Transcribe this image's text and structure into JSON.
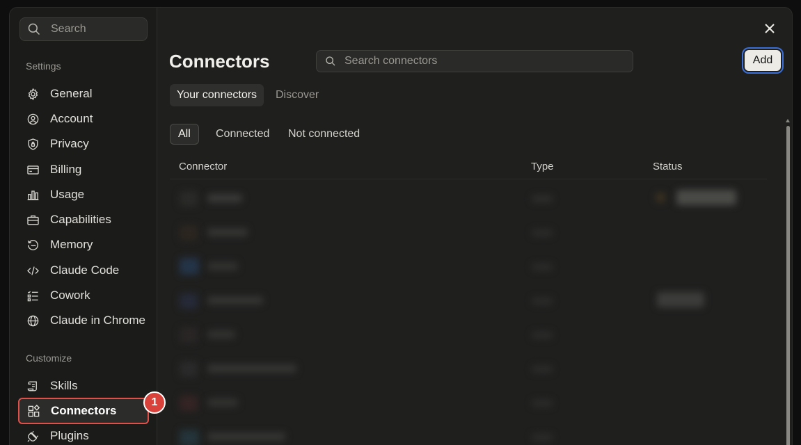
{
  "sidebar": {
    "search_placeholder": "Search",
    "settings_label": "Settings",
    "customize_label": "Customize",
    "settings_items": [
      {
        "label": "General",
        "icon": "gear-icon"
      },
      {
        "label": "Account",
        "icon": "user-circle-icon"
      },
      {
        "label": "Privacy",
        "icon": "shield-icon"
      },
      {
        "label": "Billing",
        "icon": "credit-card-icon"
      },
      {
        "label": "Usage",
        "icon": "bar-chart-icon"
      },
      {
        "label": "Capabilities",
        "icon": "briefcase-icon"
      },
      {
        "label": "Memory",
        "icon": "history-icon"
      },
      {
        "label": "Claude Code",
        "icon": "code-icon"
      },
      {
        "label": "Cowork",
        "icon": "checklist-icon"
      },
      {
        "label": "Claude in Chrome",
        "icon": "globe-icon"
      }
    ],
    "customize_items": [
      {
        "label": "Skills",
        "icon": "scroll-icon"
      },
      {
        "label": "Connectors",
        "icon": "connector-grid-icon",
        "active": true
      },
      {
        "label": "Plugins",
        "icon": "plug-icon"
      }
    ],
    "annotation_badge": "1"
  },
  "main": {
    "title": "Connectors",
    "search_placeholder": "Search connectors",
    "add_label": "Add",
    "tabs": [
      {
        "label": "Your connectors",
        "active": true
      },
      {
        "label": "Discover",
        "active": false
      }
    ],
    "filters": [
      {
        "label": "All",
        "active": true
      },
      {
        "label": "Connected",
        "active": false
      },
      {
        "label": "Not connected",
        "active": false
      }
    ],
    "columns": [
      "Connector",
      "Type",
      "Status"
    ]
  },
  "colors": {
    "accent_focus": "#3a6fd8",
    "annotation_red": "#d8423b",
    "background": "#1f1f1e"
  }
}
